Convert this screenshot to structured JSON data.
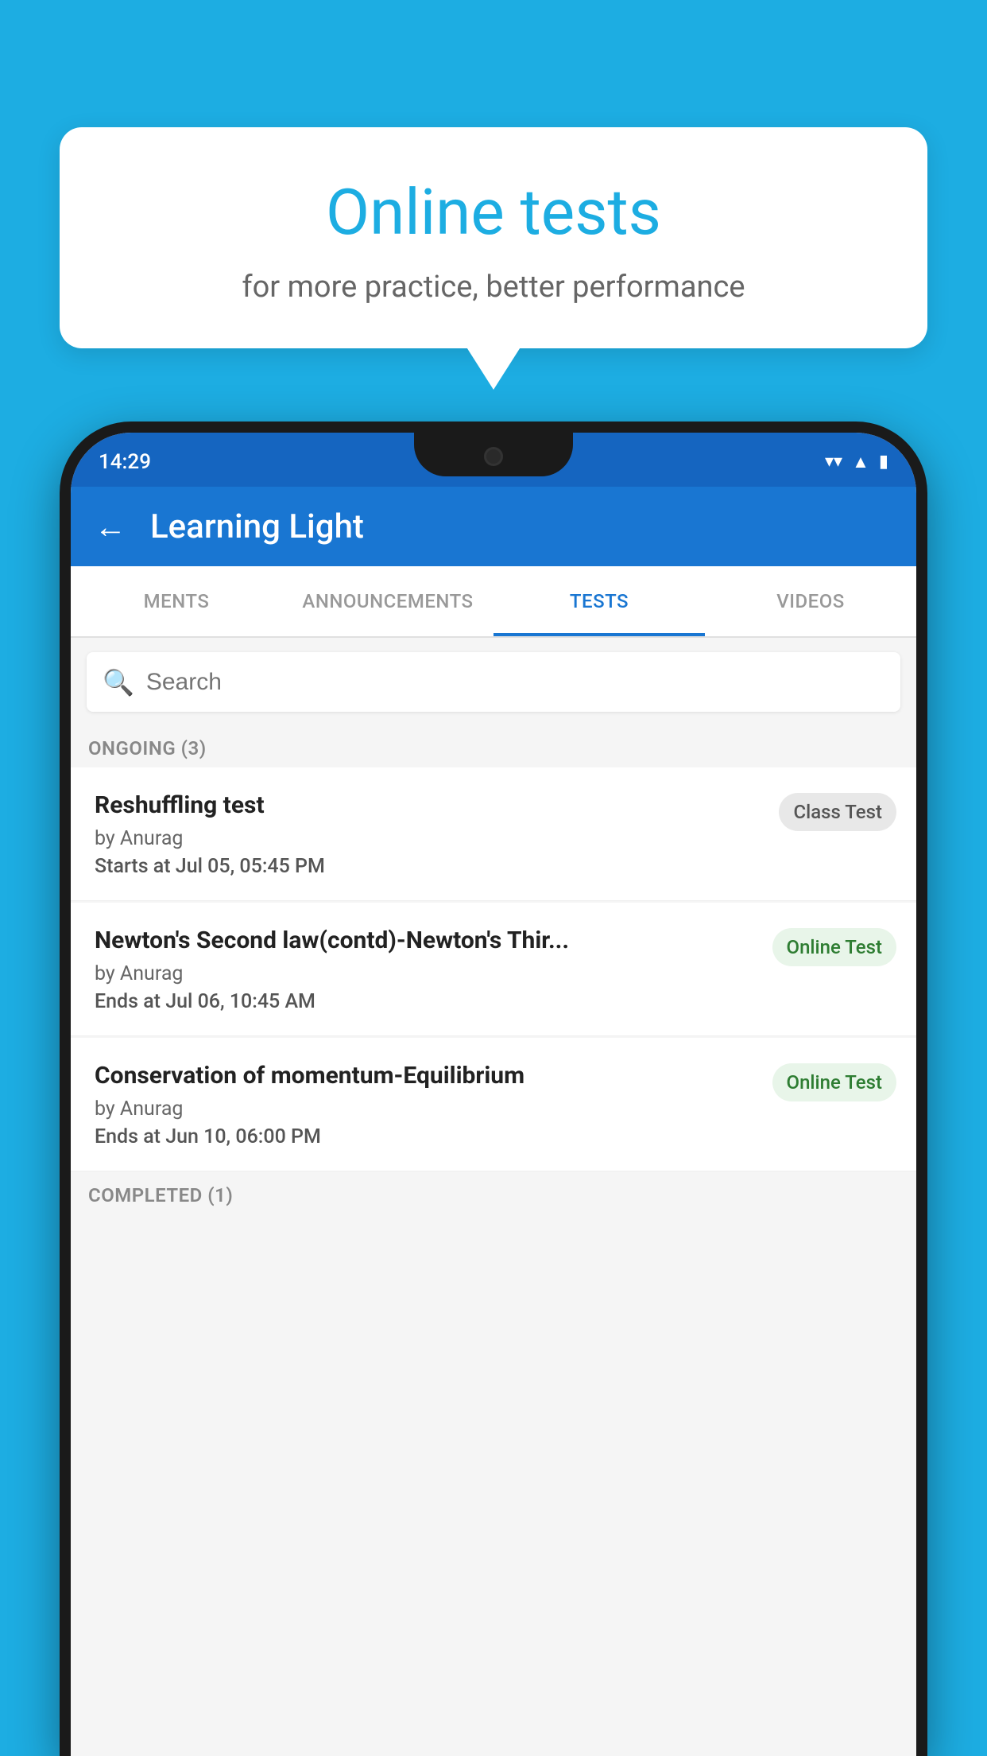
{
  "background_color": "#1DADE2",
  "bubble": {
    "title": "Online tests",
    "subtitle": "for more practice, better performance"
  },
  "status_bar": {
    "time": "14:29",
    "wifi_icon": "▼",
    "signal_icon": "▲",
    "battery_icon": "▮"
  },
  "app_bar": {
    "back_label": "←",
    "title": "Learning Light"
  },
  "tabs": [
    {
      "label": "MENTS",
      "active": false
    },
    {
      "label": "ANNOUNCEMENTS",
      "active": false
    },
    {
      "label": "TESTS",
      "active": true
    },
    {
      "label": "VIDEOS",
      "active": false
    }
  ],
  "search": {
    "placeholder": "Search",
    "icon": "🔍"
  },
  "ongoing_section": {
    "label": "ONGOING (3)"
  },
  "tests": [
    {
      "name": "Reshuffling test",
      "by": "by Anurag",
      "date_label": "Starts at",
      "date": "Jul 05, 05:45 PM",
      "badge": "Class Test",
      "badge_type": "class"
    },
    {
      "name": "Newton's Second law(contd)-Newton's Thir...",
      "by": "by Anurag",
      "date_label": "Ends at",
      "date": "Jul 06, 10:45 AM",
      "badge": "Online Test",
      "badge_type": "online"
    },
    {
      "name": "Conservation of momentum-Equilibrium",
      "by": "by Anurag",
      "date_label": "Ends at",
      "date": "Jun 10, 06:00 PM",
      "badge": "Online Test",
      "badge_type": "online"
    }
  ],
  "completed_section": {
    "label": "COMPLETED (1)"
  }
}
